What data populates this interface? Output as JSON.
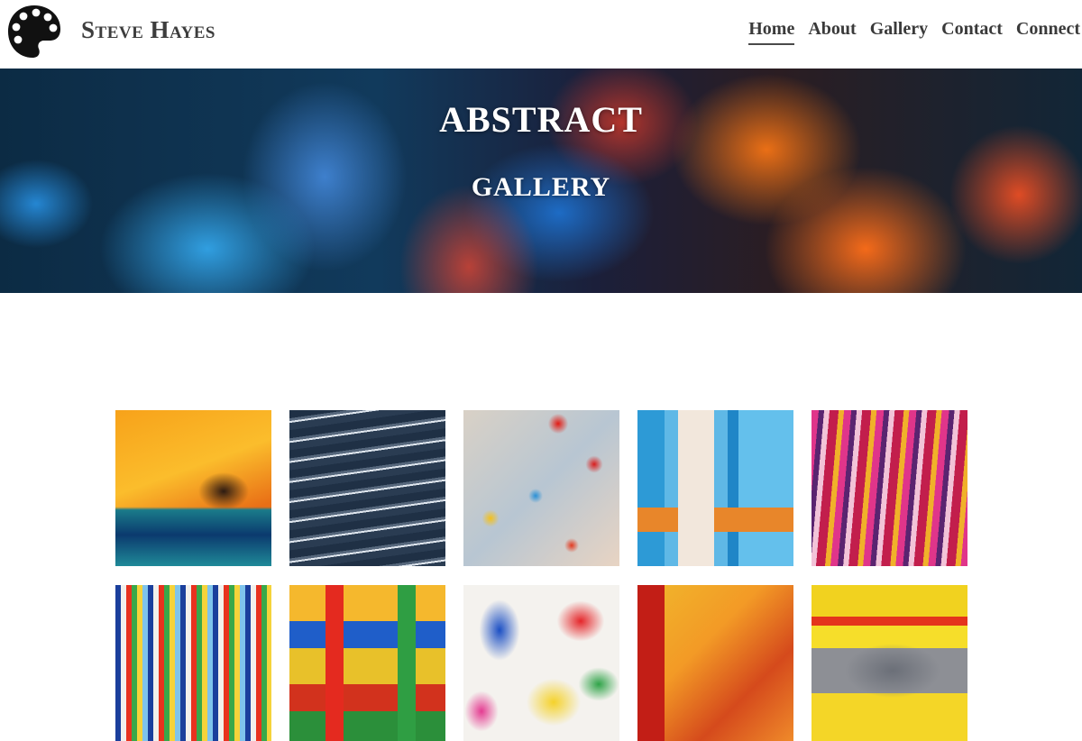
{
  "site": {
    "brand": "Steve Hayes",
    "logo_icon": "palette-icon"
  },
  "nav": {
    "items": [
      {
        "label": "Home",
        "active": true
      },
      {
        "label": "About",
        "active": false
      },
      {
        "label": "Gallery",
        "active": false
      },
      {
        "label": "Contact",
        "active": false
      },
      {
        "label": "Connect",
        "active": false
      }
    ]
  },
  "hero": {
    "title_line1": "ABSTRACT",
    "title_line2": "GALLERY"
  },
  "colors": {
    "nav_text": "#3a3a3a",
    "brand_text": "#3d3d3d",
    "hero_text": "#ffffff"
  }
}
